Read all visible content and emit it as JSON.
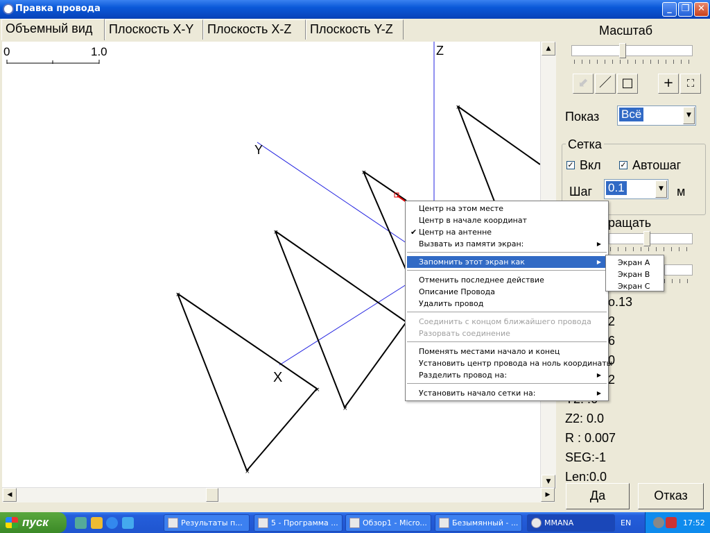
{
  "window": {
    "title": "Правка провода"
  },
  "tabs": [
    "Объемный вид",
    "Плоскость X-Y",
    "Плоскость  X-Z",
    "Плоскость Y-Z"
  ],
  "scale_bar": {
    "start": "0",
    "end": "1.0"
  },
  "axes": {
    "z_label": "Z",
    "y_label": "Y",
    "origin_marker": "X"
  },
  "right_panel": {
    "scale_label": "Масштаб",
    "show_label": "Показ",
    "show_value": "Всё",
    "grid": {
      "group_label": "Сетка",
      "on_label": "Вкл",
      "on_checked": true,
      "autostep_label": "Автошаг",
      "autostep_checked": true,
      "step_label": "Шаг",
      "step_value": "0.1",
      "step_unit": "м"
    },
    "rotate_label": "ращать",
    "info_lines": [
      "o.13",
      "2",
      "6",
      "0",
      "2",
      "Y2:  .6",
      "Z2: 0.0",
      "R : 0.007",
      "SEG:-1",
      "Len:0.0"
    ],
    "ok_button": "Да",
    "cancel_button": "Отказ"
  },
  "context_menu": {
    "items": [
      {
        "label": "Центр на этом месте",
        "disabled": false,
        "checked": false,
        "submenu": false
      },
      {
        "label": "Центр в начале координат",
        "disabled": false,
        "checked": false,
        "submenu": false
      },
      {
        "label": "Центр на антенне",
        "disabled": false,
        "checked": true,
        "submenu": false
      },
      {
        "label": "Вызвать из памяти экран:",
        "disabled": false,
        "checked": false,
        "submenu": true
      },
      {
        "label": "Запомнить этот экран как",
        "disabled": false,
        "checked": false,
        "submenu": true,
        "highlighted": true
      },
      {
        "label": "Отменить последнее действие",
        "disabled": false,
        "checked": false,
        "submenu": false
      },
      {
        "label": "Описание Провода",
        "disabled": false,
        "checked": false,
        "submenu": false
      },
      {
        "label": "Удалить провод",
        "disabled": false,
        "checked": false,
        "submenu": false
      },
      {
        "label": "Соединить с концом ближайшего провода",
        "disabled": true,
        "checked": false,
        "submenu": false
      },
      {
        "label": "Разорвать соединение",
        "disabled": true,
        "checked": false,
        "submenu": false
      },
      {
        "label": "Поменять местами начало и конец",
        "disabled": false,
        "checked": false,
        "submenu": false
      },
      {
        "label": "Установить центр провода на ноль координаты",
        "disabled": false,
        "checked": false,
        "submenu": false
      },
      {
        "label": "Разделить провод на:",
        "disabled": false,
        "checked": false,
        "submenu": true
      },
      {
        "label": "Установить начало сетки на:",
        "disabled": false,
        "checked": false,
        "submenu": true
      }
    ],
    "submenu_items": [
      "Экран A",
      "Экран B",
      "Экран C"
    ]
  },
  "taskbar": {
    "start_label": "пуск",
    "tasks": [
      "Результаты п...",
      "5 - Программа ...",
      "Обзор1 - Micro...",
      "Безымянный - ...",
      "MMANA"
    ],
    "language": "EN",
    "clock": "17:52"
  },
  "colors": {
    "axis_blue": "#2020e0",
    "wire": "#000000",
    "highlight": "#316ac5",
    "selected_wire": "#e00000"
  }
}
